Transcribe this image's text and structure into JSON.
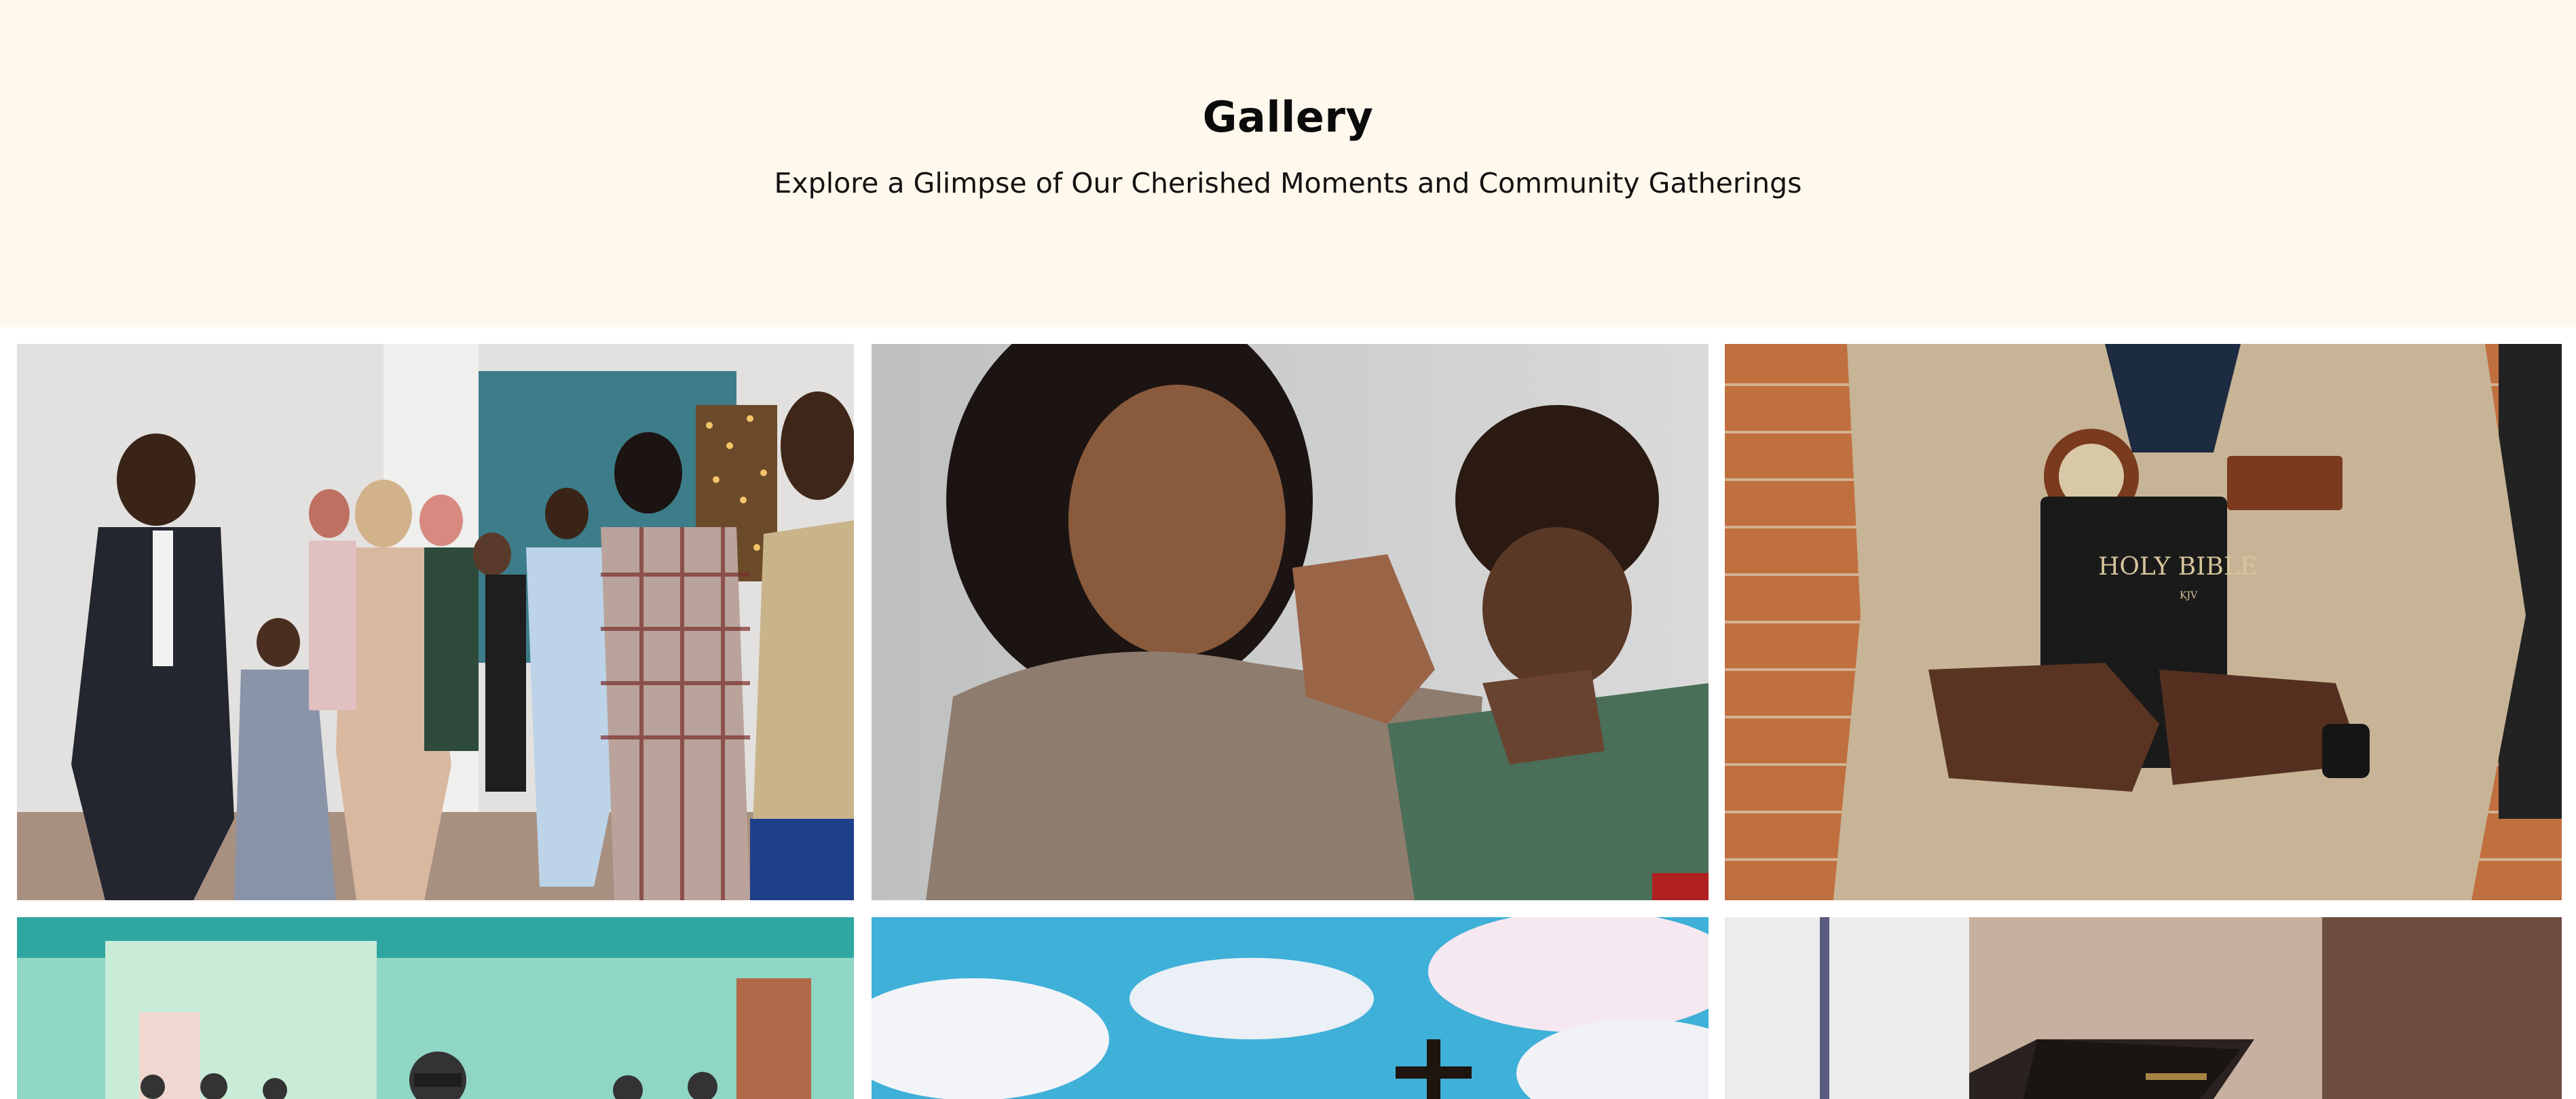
{
  "header": {
    "title": "Gallery",
    "subtitle": "Explore a Glimpse of Our Cherished Moments and Community Gatherings"
  },
  "gallery": {
    "images": [
      {
        "subject": "congregation gathering with offering plate"
      },
      {
        "subject": "woman and boy praying with folded hands"
      },
      {
        "subject": "man in flight suit holding Holy Bible",
        "book_title": "HOLY BIBLE",
        "book_edition": "KJV"
      },
      {
        "subject": "audience seated in church hall"
      },
      {
        "subject": "cross against blue sky with clouds"
      },
      {
        "subject": "bible resting on church pew"
      }
    ]
  },
  "colors": {
    "hero_background": "#fff8ed",
    "heading": "#0b0b0b",
    "page_background": "#ffffff"
  }
}
